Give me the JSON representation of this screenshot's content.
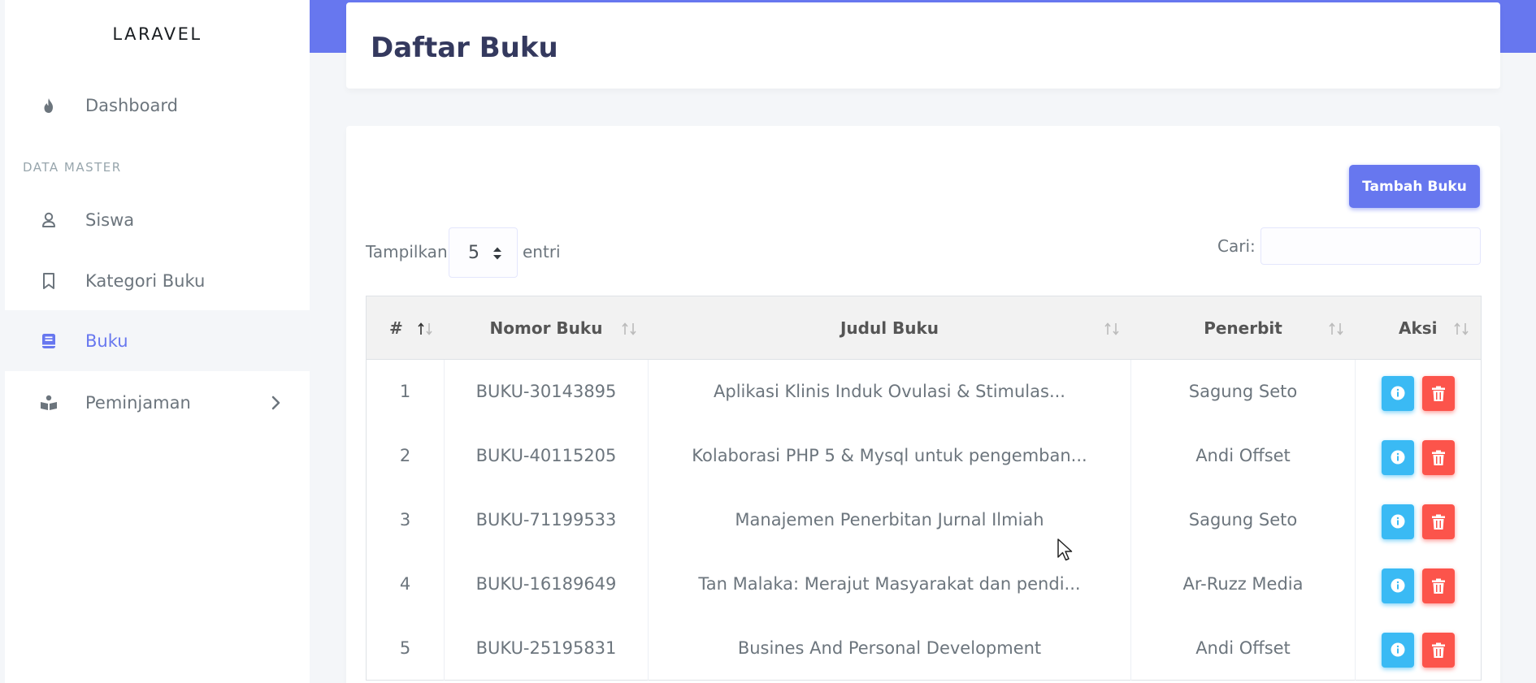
{
  "sidebar": {
    "brand": "LARAVEL",
    "menu_header": "DATA MASTER",
    "items": [
      {
        "label": "Dashboard",
        "icon": "fire-icon",
        "active": false
      },
      {
        "label": "Siswa",
        "icon": "user-icon",
        "active": false
      },
      {
        "label": "Kategori Buku",
        "icon": "bookmark-icon",
        "active": false
      },
      {
        "label": "Buku",
        "icon": "book-icon",
        "active": true
      },
      {
        "label": "Peminjaman",
        "icon": "book-reader-icon",
        "active": false,
        "has_submenu": true
      }
    ]
  },
  "header": {
    "title": "Daftar Buku"
  },
  "toolbar": {
    "add_label": "Tambah Buku",
    "show_prefix": "Tampilkan",
    "show_value": "5",
    "show_suffix": "entri",
    "search_label": "Cari:",
    "search_value": ""
  },
  "table": {
    "columns": [
      "#",
      "Nomor Buku",
      "Judul Buku",
      "Penerbit",
      "Aksi"
    ],
    "rows": [
      {
        "no": "1",
        "nomor": "BUKU-30143895",
        "judul": "Aplikasi Klinis Induk Ovulasi & Stimulas...",
        "penerbit": "Sagung Seto"
      },
      {
        "no": "2",
        "nomor": "BUKU-40115205",
        "judul": "Kolaborasi PHP 5 & Mysql untuk pengemban...",
        "penerbit": "Andi Offset"
      },
      {
        "no": "3",
        "nomor": "BUKU-71199533",
        "judul": "Manajemen Penerbitan Jurnal Ilmiah",
        "penerbit": "Sagung Seto"
      },
      {
        "no": "4",
        "nomor": "BUKU-16189649",
        "judul": "Tan Malaka: Merajut Masyarakat dan pendi...",
        "penerbit": "Ar-Ruzz Media"
      },
      {
        "no": "5",
        "nomor": "BUKU-25195831",
        "judul": "Busines And Personal Development",
        "penerbit": "Andi Offset"
      }
    ]
  },
  "colors": {
    "primary": "#6777ef",
    "info": "#3abaf4",
    "danger": "#fc544b",
    "title": "#34395e",
    "text": "#6c757d"
  }
}
